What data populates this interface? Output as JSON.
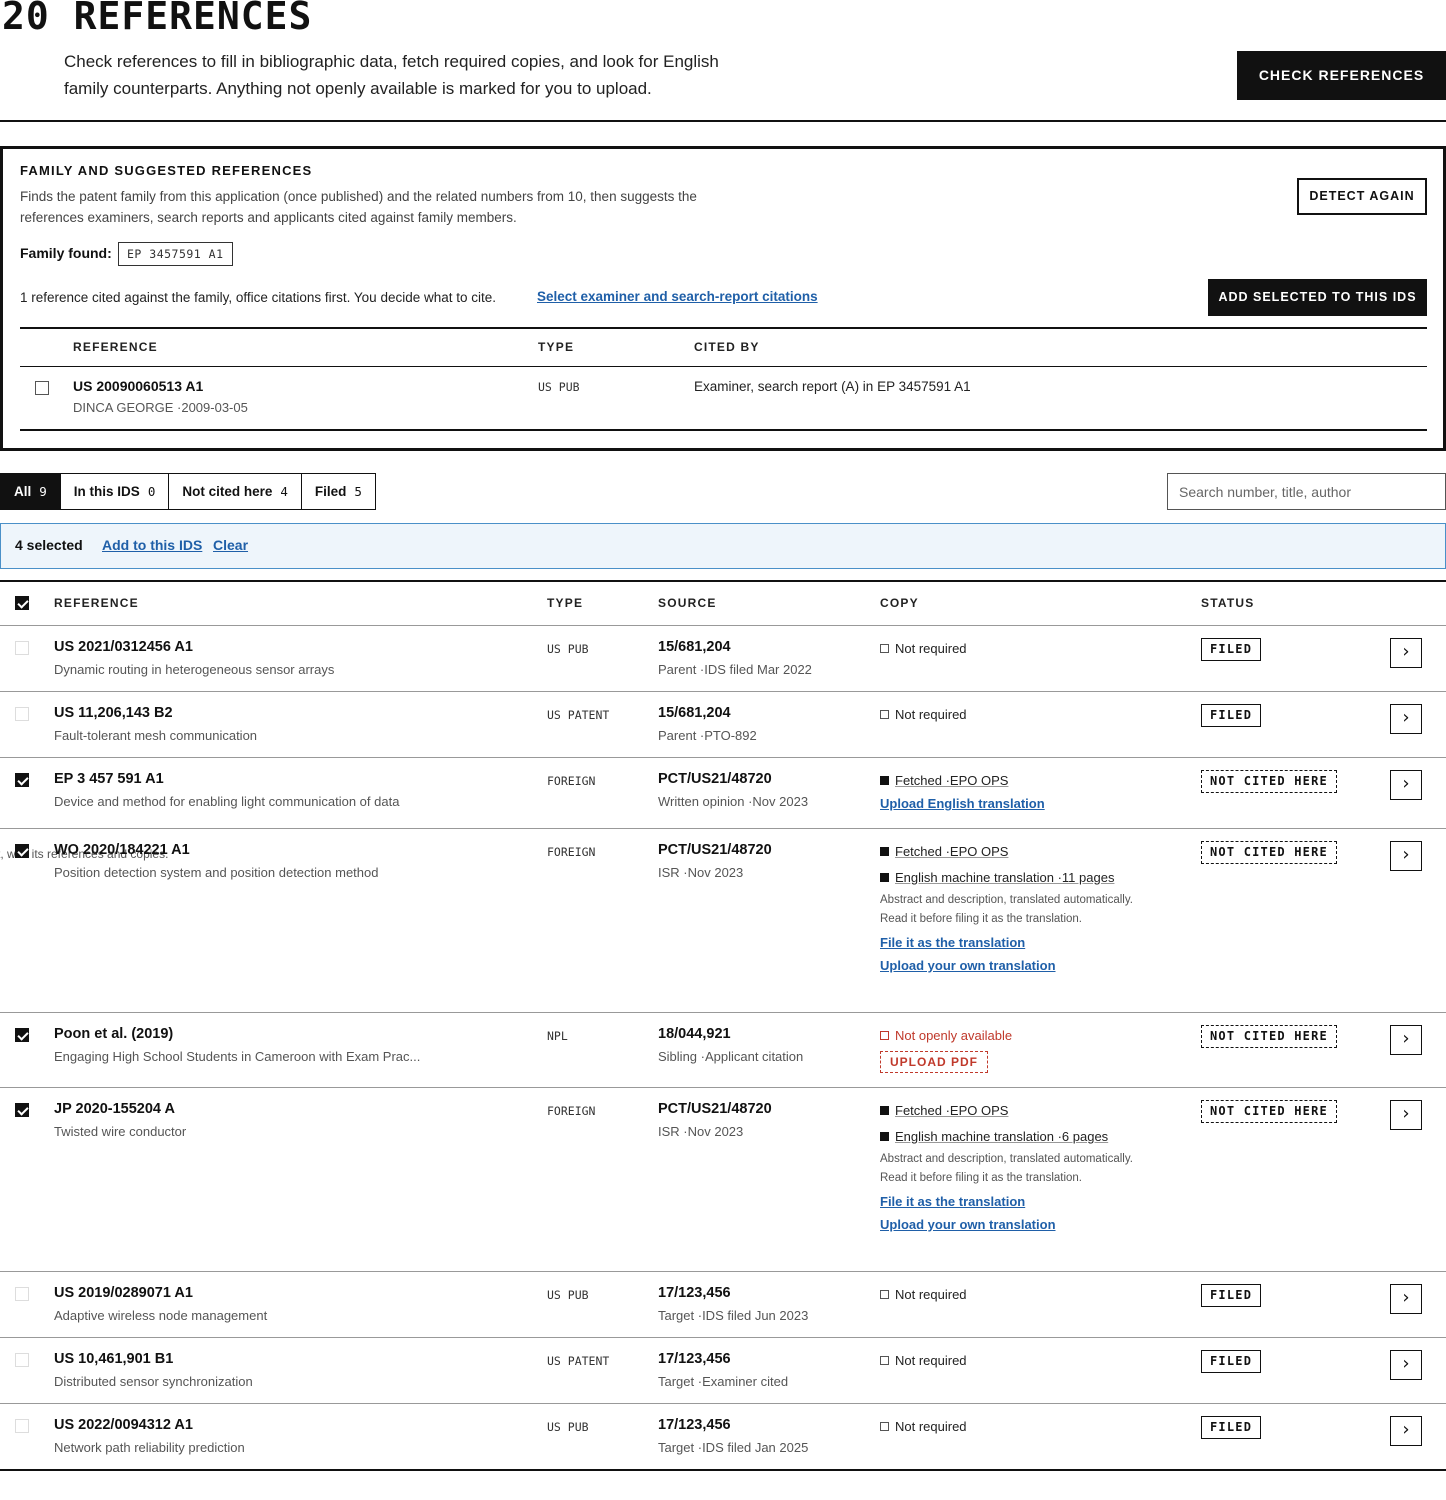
{
  "header": {
    "title": "20 REFERENCES",
    "description": "Check references to fill in bibliographic data, fetch required copies, and look for English family counterparts. Anything not openly available is marked for you to upload.",
    "check_button": "CHECK REFERENCES"
  },
  "family": {
    "title": "FAMILY AND SUGGESTED REFERENCES",
    "description": "Finds the patent family from this application (once published) and the related numbers from 10, then suggests the references examiners, search reports and applicants cited against family members.",
    "detect_button": "DETECT AGAIN",
    "found_label": "Family found:",
    "found_value": "EP 3457591 A1",
    "cited_text": "1 reference cited against the family, office citations first. You decide what to cite.",
    "select_link": "Select examiner and search-report citations",
    "add_button": "ADD SELECTED TO THIS IDS",
    "columns": [
      "REFERENCE",
      "TYPE",
      "CITED BY"
    ],
    "rows": [
      {
        "number": "US 20090060513 A1",
        "sub": "DINCA GEORGE ·2009-03-05",
        "type": "US PUB",
        "cited_by": "Examiner, search report (A) in EP 3457591 A1",
        "checked": false
      }
    ]
  },
  "tabs": [
    {
      "label": "All",
      "count": "9",
      "active": true
    },
    {
      "label": "In this IDS",
      "count": "0",
      "active": false
    },
    {
      "label": "Not cited here",
      "count": "4",
      "active": false
    },
    {
      "label": "Filed",
      "count": "5",
      "active": false
    }
  ],
  "search": {
    "placeholder": "Search number, title, author"
  },
  "selection": {
    "count_text": "4 selected",
    "add_link": "Add to this IDS",
    "clear_link": "Clear"
  },
  "table": {
    "columns": [
      "REFERENCE",
      "TYPE",
      "SOURCE",
      "COPY",
      "STATUS"
    ],
    "rows": [
      {
        "number": "US 2021/0312456 A1",
        "title": "Dynamic routing in heterogeneous sensor arrays",
        "type": "US PUB",
        "source": "15/681,204",
        "source_sub": "Parent ·IDS filed Mar 2022",
        "copy_status": "Not required",
        "status": "FILED",
        "checked": false
      },
      {
        "number": "US 11,206,143 B2",
        "title": "Fault-tolerant mesh communication",
        "type": "US PATENT",
        "source": "15/681,204",
        "source_sub": "Parent ·PTO-892",
        "copy_status": "Not required",
        "status": "FILED",
        "checked": false
      },
      {
        "number": "EP 3 457 591 A1",
        "title": "Device and method for enabling light communication of data",
        "type": "FOREIGN",
        "source": "PCT/US21/48720",
        "source_sub": "Written opinion ·Nov 2023",
        "copy_status": "Fetched ·EPO OPS",
        "action_1": "Upload English translation",
        "status": "NOT CITED HERE",
        "checked": true
      },
      {
        "number": "WO 2020/184221 A1",
        "title": "Position detection system and position detection method",
        "ghost_text": "t, with its references and copies.",
        "type": "FOREIGN",
        "source": "PCT/US21/48720",
        "source_sub": "ISR ·Nov 2023",
        "copy_status": "Fetched ·EPO OPS",
        "translation": "English machine translation ·11 pages",
        "note": "Abstract and description, translated automatically. Read it before filing it as the translation.",
        "action_1": "File it as the translation",
        "action_2": "Upload your own translation",
        "status": "NOT CITED HERE",
        "checked": true
      },
      {
        "number": "Poon et al. (2019)",
        "title": "Engaging High School Students in Cameroon with Exam Prac...",
        "type": "NPL",
        "source": "18/044,921",
        "source_sub": "Sibling ·Applicant citation",
        "copy_status": "Not openly available",
        "upload_button": "UPLOAD PDF",
        "status": "NOT CITED HERE",
        "checked": true
      },
      {
        "number": "JP 2020-155204 A",
        "title": "Twisted wire conductor",
        "type": "FOREIGN",
        "source": "PCT/US21/48720",
        "source_sub": "ISR ·Nov 2023",
        "copy_status": "Fetched ·EPO OPS",
        "translation": "English machine translation ·6 pages",
        "note": "Abstract and description, translated automatically. Read it before filing it as the translation.",
        "action_1": "File it as the translation",
        "action_2": "Upload your own translation",
        "status": "NOT CITED HERE",
        "checked": true
      },
      {
        "number": "US 2019/0289071 A1",
        "title": "Adaptive wireless node management",
        "type": "US PUB",
        "source": "17/123,456",
        "source_sub": "Target ·IDS filed Jun 2023",
        "copy_status": "Not required",
        "status": "FILED",
        "checked": false
      },
      {
        "number": "US 10,461,901 B1",
        "title": "Distributed sensor synchronization",
        "type": "US PATENT",
        "source": "17/123,456",
        "source_sub": "Target ·Examiner cited",
        "copy_status": "Not required",
        "status": "FILED",
        "checked": false
      },
      {
        "number": "US 2022/0094312 A1",
        "title": "Network path reliability prediction",
        "type": "US PUB",
        "source": "17/123,456",
        "source_sub": "Target ·IDS filed Jan 2025",
        "copy_status": "Not required",
        "status": "FILED",
        "checked": false
      }
    ]
  },
  "icons": {
    "row_open": "chevron-right-icon",
    "checkbox": "checkbox-icon"
  },
  "colors": {
    "link": "#1f5fa8",
    "accent_dark": "#111111",
    "warning": "#c0392b",
    "selection_bg": "#eef5fb"
  }
}
